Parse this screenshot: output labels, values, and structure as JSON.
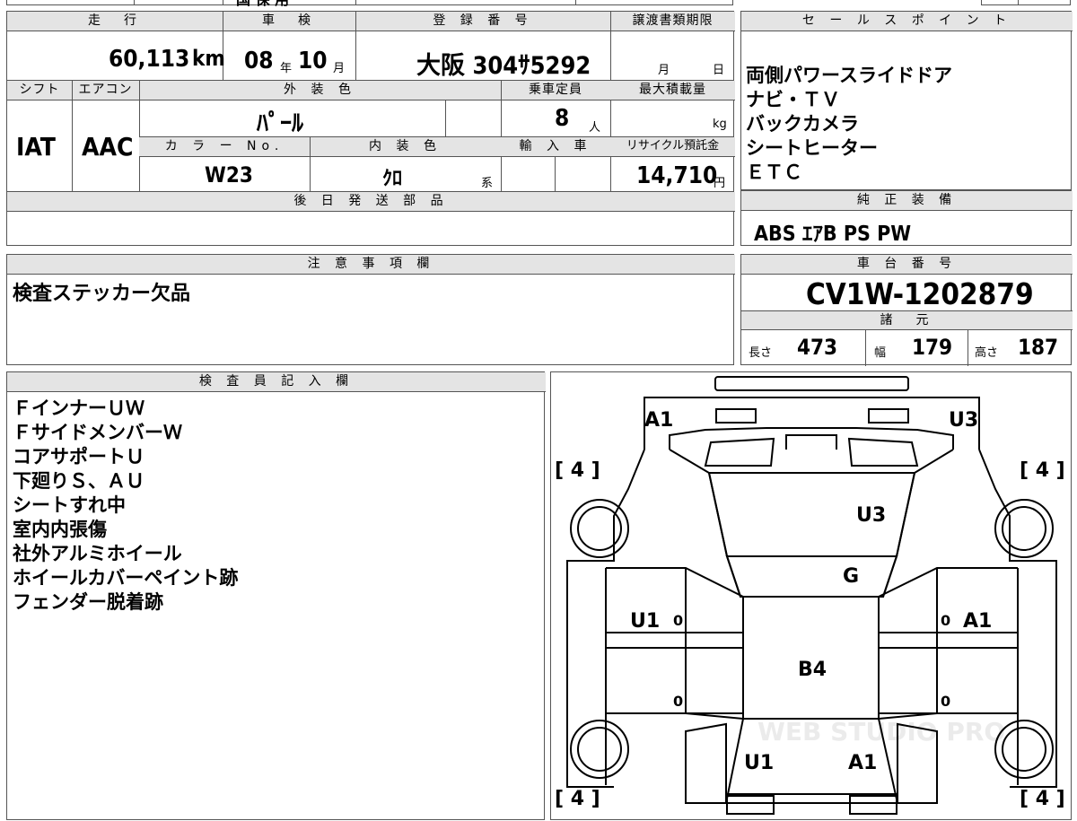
{
  "top_strip": {
    "partial_text": "国 保 用"
  },
  "mileage": {
    "header": "走　行",
    "value": "60,113",
    "unit": "km"
  },
  "inspection": {
    "header": "車　検",
    "year": "08",
    "year_unit": "年",
    "month": "10",
    "month_unit": "月"
  },
  "registration": {
    "header": "登 録 番 号",
    "value": "大阪 304ｻ5292"
  },
  "transfer_deadline": {
    "header": "譲渡書類期限",
    "month_unit": "月",
    "day_unit": "日"
  },
  "shift": {
    "header": "シフト",
    "value": "IAT"
  },
  "aircon": {
    "header": "エアコン",
    "value": "AAC"
  },
  "exterior_color": {
    "header": "外 装 色",
    "value": "ﾊﾟｰﾙ"
  },
  "capacity": {
    "header": "乗車定員",
    "value": "8",
    "unit": "人"
  },
  "max_load": {
    "header": "最大積載量",
    "unit": "kg"
  },
  "color_no": {
    "header": "カ ラ ー No.",
    "value": "W23"
  },
  "interior_color": {
    "header": "内 装 色",
    "value": "ｸﾛ",
    "suffix": "系"
  },
  "import": {
    "header": "輸 入 車"
  },
  "recycle": {
    "header": "リサイクル預託金",
    "value": "14,710",
    "unit": "円"
  },
  "later_parts": {
    "header": "後 日 発 送 部 品"
  },
  "sales_points": {
    "header": "セ ー ル ス ポ イ ン ト",
    "items": [
      "両側パワースライドドア",
      "ナビ・ＴＶ",
      "バックカメラ",
      "シートヒーター",
      "ＥＴＣ"
    ]
  },
  "equipment": {
    "header": "純 正 装 備",
    "value": "ABS ｴｱB PS PW"
  },
  "notes": {
    "header": "注 意 事 項 欄",
    "text": "検査ステッカー欠品"
  },
  "chassis": {
    "header": "車 台 番 号",
    "value": "CV1W-1202879"
  },
  "specs": {
    "header": "諸　元",
    "length_label": "長さ",
    "length": "473",
    "width_label": "幅",
    "width": "179",
    "height_label": "高さ",
    "height": "187"
  },
  "inspector": {
    "header": "検 査 員 記 入 欄",
    "items": [
      "ＦインナーＵＷ",
      "ＦサイドメンバーＷ",
      "コアサポートＵ",
      "下廻りＳ、ＡＵ",
      "シートすれ中",
      "室内内張傷",
      "社外アルミホイール",
      "ホイールカバーペイント跡",
      "フェンダー脱着跡"
    ]
  },
  "diagram": {
    "marks": {
      "front_left": "A1",
      "front_right": "U3",
      "windshield": "U3",
      "roof_front": "G",
      "left_door": "U1",
      "right_door": "A1",
      "roof": "B4",
      "rear_left": "U1",
      "rear_right": "A1"
    },
    "tire_marks": {
      "front_left": "[ 4 ]",
      "front_right": "[ 4 ]",
      "rear_left": "[ 4 ]",
      "rear_right": "[ 4 ]"
    },
    "zero_marks": [
      "0",
      "0",
      "0",
      "0"
    ],
    "watermark": "WEB STUDIO PRO"
  }
}
